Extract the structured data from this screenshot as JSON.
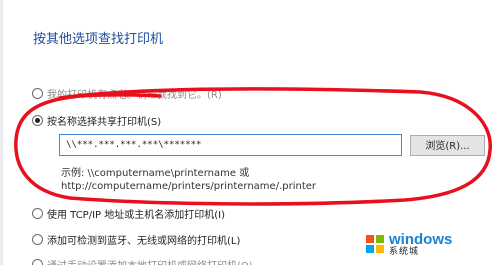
{
  "dialog": {
    "title": "按其他选项查找打印机"
  },
  "options": [
    {
      "label": "我的打印机有点老。请帮我找到它。(R)",
      "selected": false
    },
    {
      "label": "按名称选择共享打印机(S)",
      "selected": true
    },
    {
      "label": "使用 TCP/IP 地址或主机名添加打印机(I)",
      "selected": false
    },
    {
      "label": "添加可检测到蓝牙、无线或网络的打印机(L)",
      "selected": false
    },
    {
      "label": "通过手动设置添加本地打印机或网络打印机(O)",
      "selected": false
    }
  ],
  "share_input": {
    "value": "\\\\***.***.***.***\\*******"
  },
  "browse_button": {
    "label": "浏览(R)..."
  },
  "example": {
    "line1": "示例: \\\\computername\\printername 或",
    "line2": "http://computername/printers/printername/.printer"
  },
  "watermark": {
    "brand": "windows",
    "sub": "系统城",
    "colors": [
      "#f25022",
      "#7fba00",
      "#00a4ef",
      "#ffb900"
    ]
  },
  "annotation_color": "#e8101c"
}
